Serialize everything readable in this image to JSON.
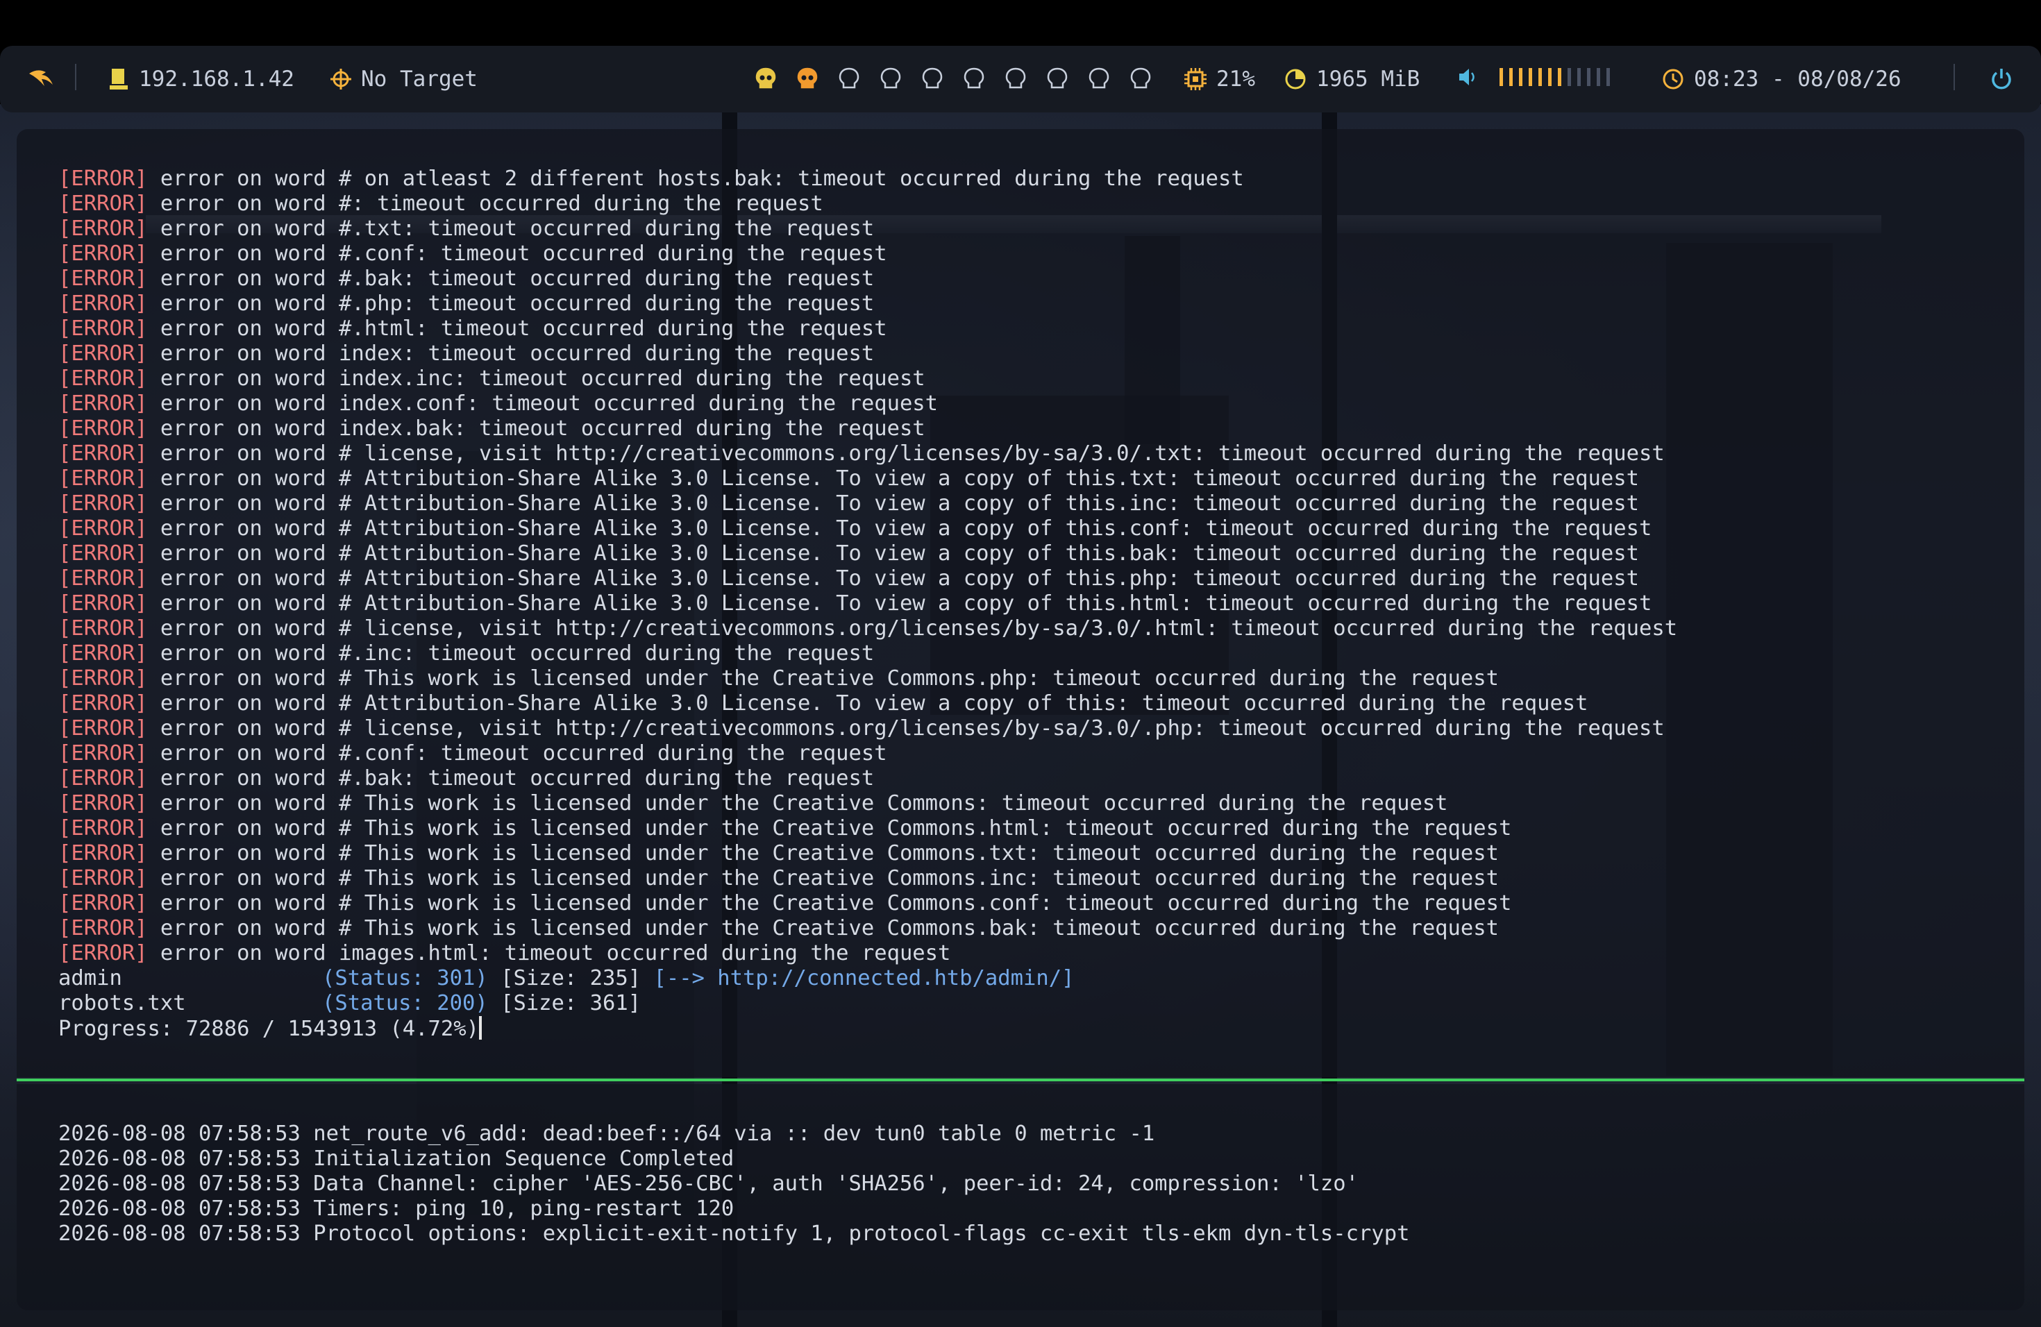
{
  "statusbar": {
    "ip_address": "192.168.1.42",
    "target": "No Target",
    "workspaces": [
      {
        "state": "active"
      },
      {
        "state": "occupied"
      },
      {
        "state": "empty"
      },
      {
        "state": "empty"
      },
      {
        "state": "empty"
      },
      {
        "state": "empty"
      },
      {
        "state": "empty"
      },
      {
        "state": "empty"
      },
      {
        "state": "empty"
      },
      {
        "state": "empty"
      }
    ],
    "cpu": "21%",
    "memory": "1965 MiB",
    "volume_level": 0.58,
    "clock": "08:23 - 08/08/26",
    "colors": {
      "accent": "#f5b23c",
      "active_ws": "#e8c545",
      "occupied_ws": "#f29a2e",
      "power": "#4fb8e0",
      "ip": "#e9d24a"
    }
  },
  "terminal_top": {
    "error_tag": "[ERROR]",
    "errors": [
      "error on word # on atleast 2 different hosts.bak: timeout occurred during the request",
      "error on word #: timeout occurred during the request",
      "error on word #.txt: timeout occurred during the request",
      "error on word #.conf: timeout occurred during the request",
      "error on word #.bak: timeout occurred during the request",
      "error on word #.php: timeout occurred during the request",
      "error on word #.html: timeout occurred during the request",
      "error on word index: timeout occurred during the request",
      "error on word index.inc: timeout occurred during the request",
      "error on word index.conf: timeout occurred during the request",
      "error on word index.bak: timeout occurred during the request",
      "error on word # license, visit http://creativecommons.org/licenses/by-sa/3.0/.txt: timeout occurred during the request",
      "error on word # Attribution-Share Alike 3.0 License. To view a copy of this.txt: timeout occurred during the request",
      "error on word # Attribution-Share Alike 3.0 License. To view a copy of this.inc: timeout occurred during the request",
      "error on word # Attribution-Share Alike 3.0 License. To view a copy of this.conf: timeout occurred during the request",
      "error on word # Attribution-Share Alike 3.0 License. To view a copy of this.bak: timeout occurred during the request",
      "error on word # Attribution-Share Alike 3.0 License. To view a copy of this.php: timeout occurred during the request",
      "error on word # Attribution-Share Alike 3.0 License. To view a copy of this.html: timeout occurred during the request",
      "error on word # license, visit http://creativecommons.org/licenses/by-sa/3.0/.html: timeout occurred during the request",
      "error on word #.inc: timeout occurred during the request",
      "error on word # This work is licensed under the Creative Commons.php: timeout occurred during the request",
      "error on word # Attribution-Share Alike 3.0 License. To view a copy of this: timeout occurred during the request",
      "error on word # license, visit http://creativecommons.org/licenses/by-sa/3.0/.php: timeout occurred during the request",
      "error on word #.conf: timeout occurred during the request",
      "error on word #.bak: timeout occurred during the request",
      "error on word # This work is licensed under the Creative Commons: timeout occurred during the request",
      "error on word # This work is licensed under the Creative Commons.html: timeout occurred during the request",
      "error on word # This work is licensed under the Creative Commons.txt: timeout occurred during the request",
      "error on word # This work is licensed under the Creative Commons.inc: timeout occurred during the request",
      "error on word # This work is licensed under the Creative Commons.conf: timeout occurred during the request",
      "error on word # This work is licensed under the Creative Commons.bak: timeout occurred during the request",
      "error on word images.html: timeout occurred during the request"
    ],
    "results": [
      {
        "path": "admin",
        "status": "(Status: 301)",
        "size": "[Size: 235]",
        "redirect": "[--> http://connected.htb/admin/]"
      },
      {
        "path": "robots.txt",
        "status": "(Status: 200)",
        "size": "[Size: 361]",
        "redirect": ""
      }
    ],
    "progress": "Progress: 72886 / 1543913 (4.72%)"
  },
  "terminal_bottom": {
    "lines": [
      "2026-08-08 07:58:53 net_route_v6_add: dead:beef::/64 via :: dev tun0 table 0 metric -1",
      "2026-08-08 07:58:53 Initialization Sequence Completed",
      "2026-08-08 07:58:53 Data Channel: cipher 'AES-256-CBC', auth 'SHA256', peer-id: 24, compression: 'lzo'",
      "2026-08-08 07:58:53 Timers: ping 10, ping-restart 120",
      "2026-08-08 07:58:53 Protocol options: explicit-exit-notify 1, protocol-flags cc-exit tls-ekm dyn-tls-crypt"
    ]
  }
}
